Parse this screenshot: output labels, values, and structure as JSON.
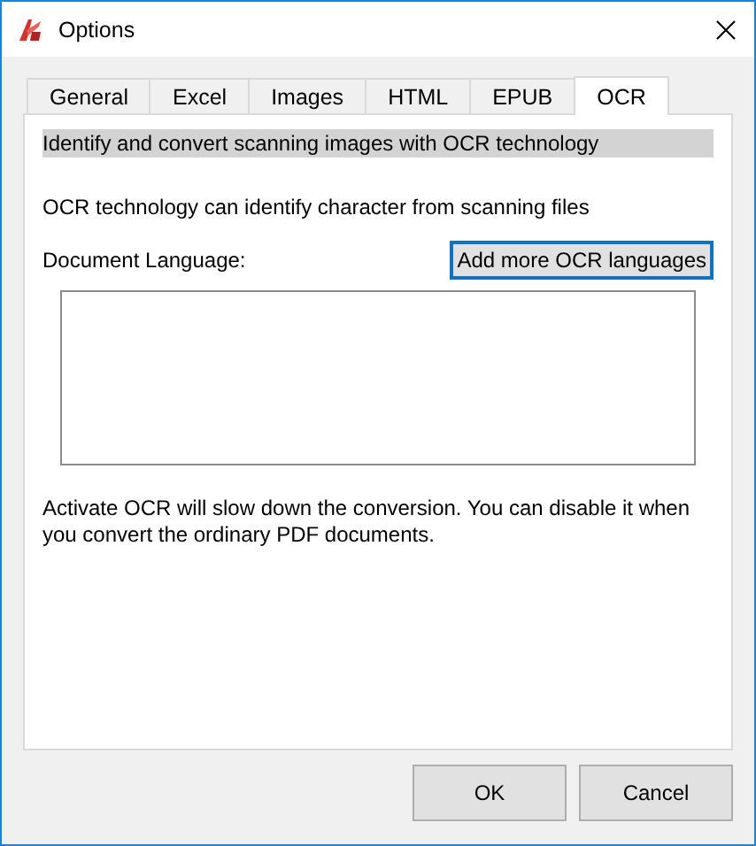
{
  "window": {
    "title": "Options"
  },
  "tabs": [
    {
      "label": "General",
      "selected": false
    },
    {
      "label": "Excel",
      "selected": false
    },
    {
      "label": "Images",
      "selected": false
    },
    {
      "label": "HTML",
      "selected": false
    },
    {
      "label": "EPUB",
      "selected": false
    },
    {
      "label": "OCR",
      "selected": true
    }
  ],
  "panel": {
    "heading": "Identify and convert scanning images with OCR technology",
    "description": "OCR technology can identify character from scanning files",
    "language_label": "Document Language:",
    "add_button": "Add more OCR languages",
    "note": "Activate OCR will slow down the conversion. You can disable it when you convert the ordinary PDF documents."
  },
  "buttons": [
    "OK",
    "Cancel"
  ]
}
